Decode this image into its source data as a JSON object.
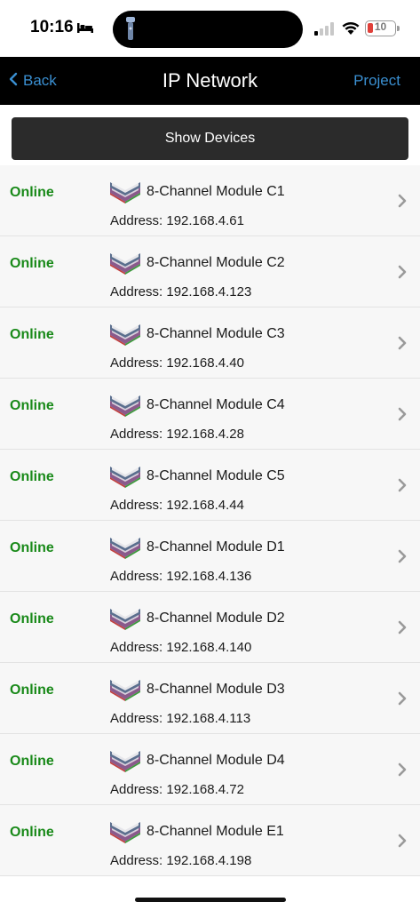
{
  "status_bar": {
    "time": "10:16",
    "battery": "10",
    "bed_icon": "bed-icon",
    "torch_icon": "flashlight-icon",
    "signal_icon": "cellular-signal-icon",
    "wifi_icon": "wifi-icon"
  },
  "nav": {
    "back_label": "Back",
    "title": "IP Network",
    "project_label": "Project",
    "accent_color": "#3a8fd1"
  },
  "show_devices_label": "Show Devices",
  "devices": [
    {
      "status": "Online",
      "name": "8-Channel Module C1",
      "address": "Address: 192.168.4.61"
    },
    {
      "status": "Online",
      "name": "8-Channel Module C2",
      "address": "Address: 192.168.4.123"
    },
    {
      "status": "Online",
      "name": "8-Channel Module C3",
      "address": "Address: 192.168.4.40"
    },
    {
      "status": "Online",
      "name": "8-Channel Module C4",
      "address": "Address: 192.168.4.28"
    },
    {
      "status": "Online",
      "name": "8-Channel Module C5",
      "address": "Address: 192.168.4.44"
    },
    {
      "status": "Online",
      "name": "8-Channel Module D1",
      "address": "Address: 192.168.4.136"
    },
    {
      "status": "Online",
      "name": "8-Channel Module D2",
      "address": "Address: 192.168.4.140"
    },
    {
      "status": "Online",
      "name": "8-Channel Module D3",
      "address": "Address: 192.168.4.113"
    },
    {
      "status": "Online",
      "name": "8-Channel Module D4",
      "address": "Address: 192.168.4.72"
    },
    {
      "status": "Online",
      "name": "8-Channel Module E1",
      "address": "Address: 192.168.4.198"
    }
  ],
  "colors": {
    "online": "#1a8a1a",
    "row_background": "#f7f7f7"
  }
}
